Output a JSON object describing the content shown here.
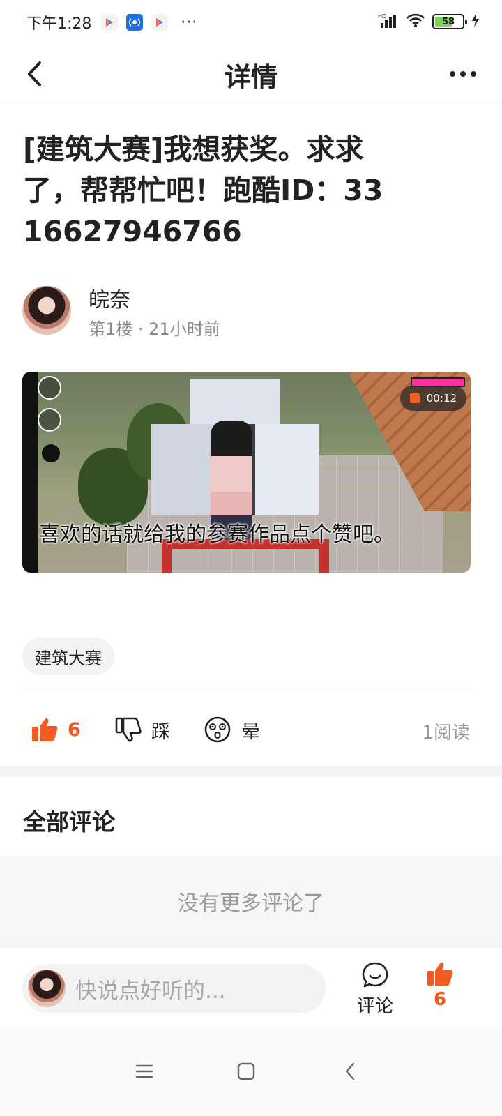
{
  "status_bar": {
    "time": "下午1:28",
    "more": "···",
    "battery": "58"
  },
  "header": {
    "title": "详情"
  },
  "post": {
    "title": "[建筑大赛]我想获奖。求求了，帮帮忙吧！跑酷ID：3316627946766",
    "author": {
      "name": "皖奈",
      "meta": "第1楼 · 21小时前"
    },
    "video": {
      "caption": "喜欢的话就给我的参赛作品点个赞吧。",
      "timer": "00:12"
    },
    "tag": "建筑大赛",
    "reactions": {
      "like_count": "6",
      "dislike_label": "踩",
      "dizzy_label": "晕"
    },
    "read_count": "1阅读"
  },
  "comments": {
    "title": "全部评论",
    "empty_text": "没有更多评论了"
  },
  "bottom_bar": {
    "placeholder": "快说点好听的...",
    "comment_label": "评论",
    "like_count": "6"
  },
  "colors": {
    "accent": "#f25a21",
    "muted": "#9b9b9b"
  }
}
